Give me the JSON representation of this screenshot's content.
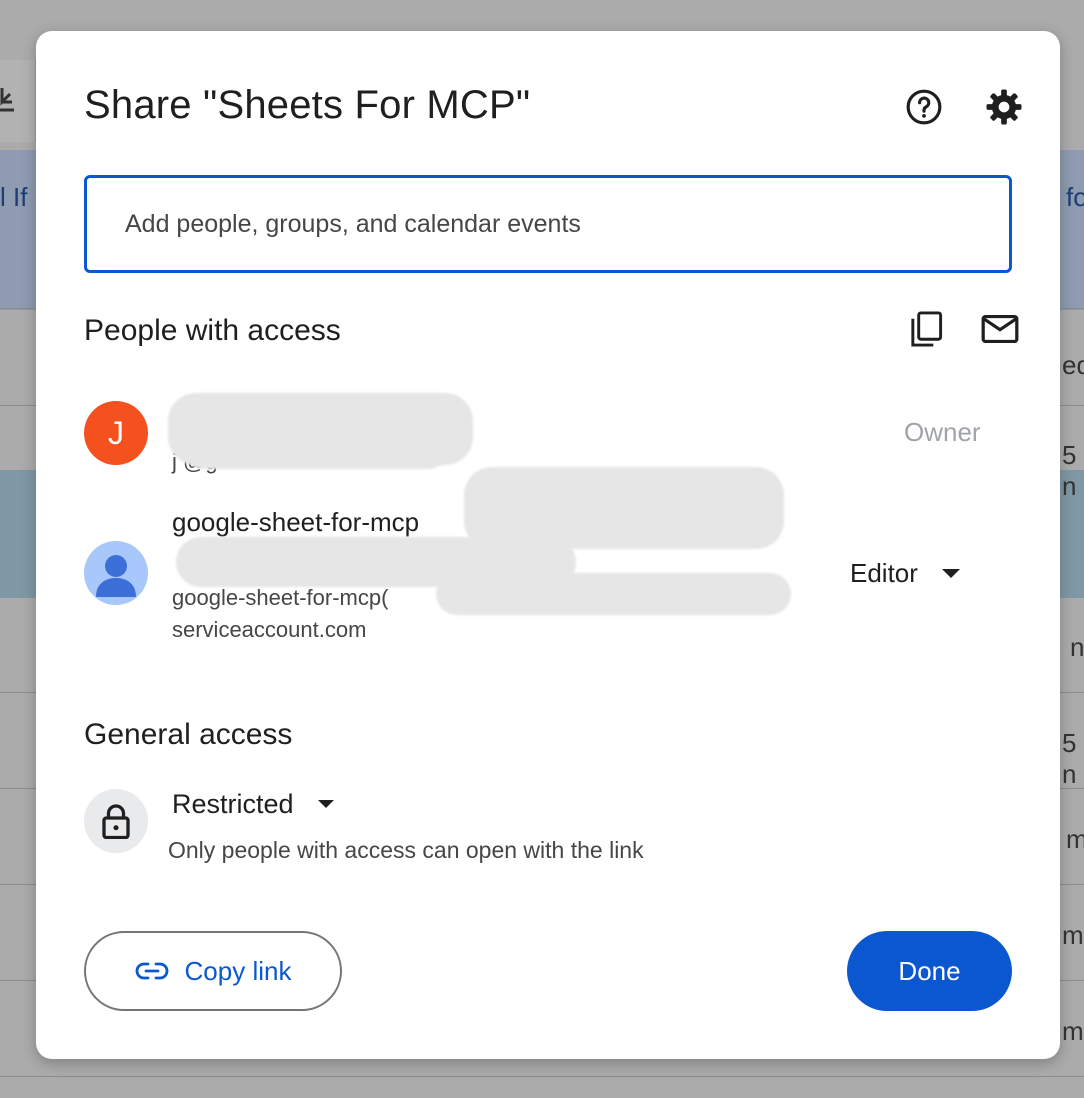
{
  "background": {
    "fragments": [
      "l If",
      "fo",
      "ed",
      "5 n",
      "n",
      "5 n",
      "m",
      "me",
      "me"
    ]
  },
  "dialog": {
    "title": "Share \"Sheets For MCP\"",
    "add_people": {
      "placeholder": "Add people, groups, and calendar events"
    },
    "people_with_access": {
      "heading": "People with access",
      "people": [
        {
          "avatar_letter": "J",
          "name": "J N",
          "email": "j @g",
          "role": "Owner"
        },
        {
          "name": "google-sheet-for-mcp",
          "email_line1": "google-sheet-for-mcp(",
          "email_line2": "serviceaccount.com",
          "role": "Editor"
        }
      ]
    },
    "general_access": {
      "heading": "General access",
      "level": "Restricted",
      "description": "Only people with access can open with the link"
    },
    "copy_link_label": "Copy link",
    "done_label": "Done"
  },
  "colors": {
    "primary": "#0b57d0",
    "owner_avatar": "#f4511e",
    "service_avatar": "#a8c7fa"
  },
  "icons": [
    "help-icon",
    "settings-icon",
    "copy-emails-icon",
    "email-icon",
    "person-icon",
    "lock-icon",
    "link-icon",
    "caret-down-icon"
  ]
}
